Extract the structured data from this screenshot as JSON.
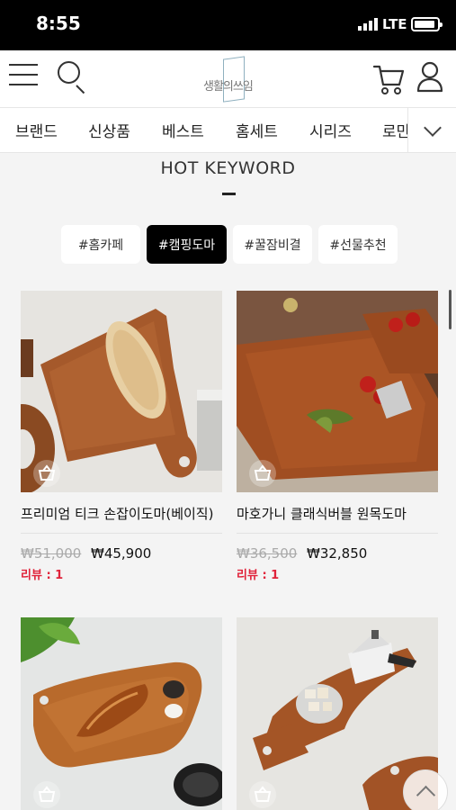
{
  "status_bar": {
    "time": "8:55",
    "network": "LTE"
  },
  "header": {
    "menu_icon": "hamburger-icon",
    "search_icon": "search-icon",
    "logo_text": "생활의쓰임",
    "cart_icon": "cart-icon",
    "user_icon": "user-icon"
  },
  "categories": [
    "브랜드",
    "신상품",
    "베스트",
    "홈세트",
    "시리즈",
    "로만"
  ],
  "hot_keyword": {
    "title": "HOT KEYWORD",
    "tags": [
      "#홈카페",
      "#캠핑도마",
      "#꿀잠비결",
      "#선물추천"
    ],
    "active_tag": "#캠핑도마"
  },
  "products": [
    {
      "name": "프리미엄 티크 손잡이도마(베이직)",
      "original_price": "₩51,000",
      "sale_price": "₩45,900",
      "review": "리뷰 : 1"
    },
    {
      "name": "마호가니 클래식버블 원목도마",
      "original_price": "₩36,500",
      "sale_price": "₩32,850",
      "review": "리뷰 : 1"
    },
    {
      "name": "",
      "original_price": "",
      "sale_price": "",
      "review": ""
    },
    {
      "name": "",
      "original_price": "",
      "sale_price": "",
      "review": ""
    }
  ],
  "colors": {
    "accent_red": "#e0223a",
    "active_tag_bg": "#000000",
    "background": "#f4f4f4"
  }
}
